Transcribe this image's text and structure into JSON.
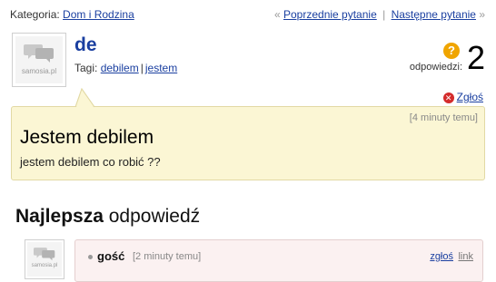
{
  "category": {
    "label": "Kategoria:",
    "value": "Dom i Rodzina"
  },
  "nav": {
    "open_quote": "«",
    "prev": "Poprzednie pytanie",
    "separator": "|",
    "next": "Następne pytanie",
    "close_quote": "»"
  },
  "question": {
    "title": "de",
    "tags_label": "Tagi:",
    "tags": [
      "debilem",
      "jestem"
    ],
    "tag_separator": "|",
    "answers_label": "odpowiedzi:",
    "answers_count": "2",
    "badge": "?",
    "report": "Zgłoś",
    "time": "[4 minuty temu]",
    "heading": "Jestem debilem",
    "body": "jestem debilem co robić ??"
  },
  "avatar": {
    "brand": "samosia.pl"
  },
  "best": {
    "heading_bold": "Najlepsza",
    "heading_rest": "odpowiedź",
    "user": "gość",
    "time": "[2 minuty temu]",
    "report": "zgłoś",
    "link": "link"
  },
  "colors": {
    "link": "#1a3fa0",
    "bubble": "#fbf6d4",
    "answer_box": "#fbf1f1",
    "badge": "#f0a500",
    "report_icon": "#d42b2b"
  },
  "icons": {
    "report": "close-circle-icon",
    "answers": "question-badge-icon",
    "avatar": "speech-bubbles-icon"
  }
}
